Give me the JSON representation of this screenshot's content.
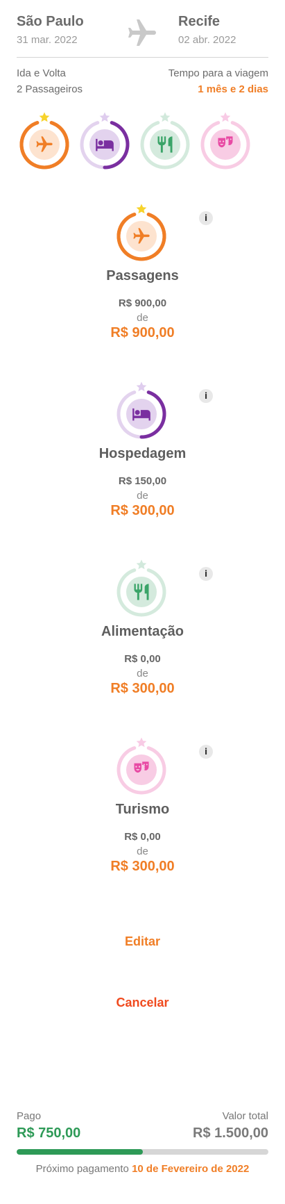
{
  "trip": {
    "origin_city": "São Paulo",
    "origin_date": "31 mar. 2022",
    "destination_city": "Recife",
    "destination_date": "02 abr. 2022",
    "trip_type": "Ida e Volta",
    "passengers": "2 Passageiros",
    "time_label": "Tempo para a viagem",
    "time_value": "1 mês e 2 dias"
  },
  "icons": {
    "airplane": "airplane-icon",
    "bed": "bed-icon",
    "utensils": "utensils-icon",
    "masks": "theater-masks-icon",
    "star": "star-icon",
    "info": "info-icon"
  },
  "info_label": "i",
  "categories": [
    {
      "id": "passagens",
      "title": "Passagens",
      "spent": "R$ 900,00",
      "of": "de",
      "budget": "R$ 900,00",
      "progress": 1.0,
      "star_color": "#f7d32b",
      "ring_color": "#f07e26",
      "track_color": "#f07e26",
      "circle_color": "#fde3cf",
      "icon_color": "#f07e26"
    },
    {
      "id": "hospedagem",
      "title": "Hospedagem",
      "spent": "R$ 150,00",
      "of": "de",
      "budget": "R$ 300,00",
      "progress": 0.5,
      "star_color": "#dfcdee",
      "ring_color": "#7a2fa0",
      "track_color": "#e3d3ee",
      "circle_color": "#e3d3ee",
      "icon_color": "#7a2fa0"
    },
    {
      "id": "alimentacao",
      "title": "Alimentação",
      "spent": "R$ 0,00",
      "of": "de",
      "budget": "R$ 300,00",
      "progress": 0.0,
      "star_color": "#d2e9dc",
      "ring_color": "#2e9a57",
      "track_color": "#d4eadd",
      "circle_color": "#d4eadd",
      "icon_color": "#3aa468"
    },
    {
      "id": "turismo",
      "title": "Turismo",
      "spent": "R$ 0,00",
      "of": "de",
      "budget": "R$ 300,00",
      "progress": 0.0,
      "star_color": "#f8cbe5",
      "ring_color": "#e84aa4",
      "track_color": "#f8cce4",
      "circle_color": "#f8cce4",
      "icon_color": "#e84aa4"
    }
  ],
  "actions": {
    "edit_label": "Editar",
    "cancel_label": "Cancelar"
  },
  "payment": {
    "paid_label": "Pago",
    "paid_value": "R$ 750,00",
    "total_label": "Valor total",
    "total_value": "R$ 1.500,00",
    "progress": 0.5,
    "next_label": "Próximo pagamento",
    "next_date": "10 de Fevereiro de 2022"
  },
  "colors": {
    "accent": "#f07e26",
    "success": "#2e9a57",
    "danger": "#f04a1e"
  }
}
